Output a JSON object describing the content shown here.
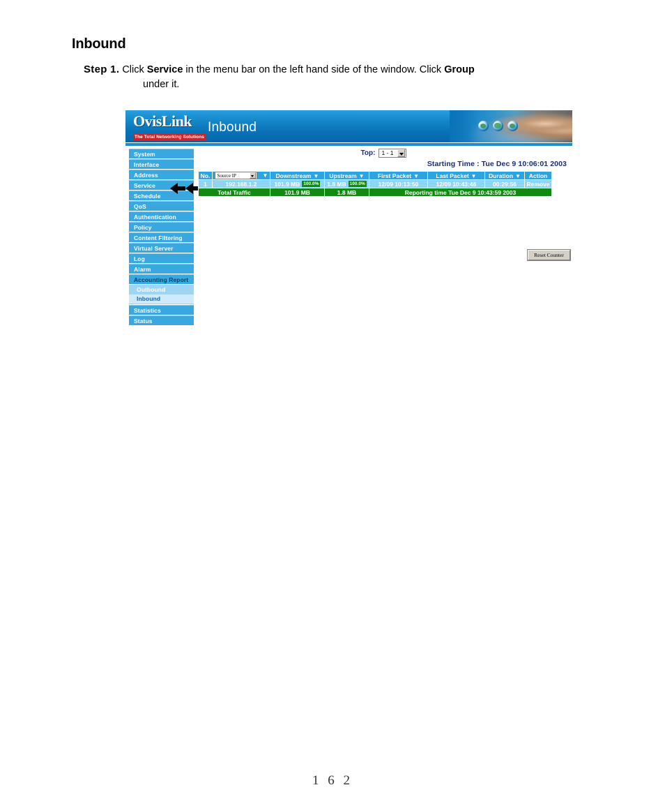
{
  "document": {
    "title": "Inbound",
    "step_label": "Step 1.",
    "step_text_1": "Click ",
    "step_bold_1": "Service",
    "step_text_2": " in the menu bar on the left hand side of the window. Click ",
    "step_bold_2": "Group",
    "step_text_3": "under it.",
    "page_number": "1 6 2"
  },
  "screenshot": {
    "banner": {
      "logo_main": "OvisLink",
      "logo_sub": "The Total Networking Solutions",
      "title": "Inbound",
      "icons": [
        "globe-icon",
        "globe-icon",
        "globe-icon"
      ]
    },
    "sidebar": {
      "items": [
        {
          "label": "System",
          "active": false
        },
        {
          "label": "Interface",
          "active": false
        },
        {
          "label": "Address",
          "active": false
        },
        {
          "label": "Service",
          "active": false
        },
        {
          "label": "Schedule",
          "active": false
        },
        {
          "label": "QoS",
          "active": false
        },
        {
          "label": "Authentication",
          "active": false
        },
        {
          "label": "Policy",
          "active": false
        },
        {
          "label": "Content Filtering",
          "active": false
        },
        {
          "label": "Virtual Server",
          "active": false
        },
        {
          "label": "Log",
          "active": false
        },
        {
          "label": "Alarm",
          "active": false
        },
        {
          "label": "Accounting Report",
          "active": true
        }
      ],
      "submenu": [
        {
          "label": "Outbound",
          "selected": false
        },
        {
          "label": "Inbound",
          "selected": true
        }
      ],
      "items_after": [
        {
          "label": "Statistics",
          "active": false
        },
        {
          "label": "Status",
          "active": false
        }
      ],
      "annotation": "two-left-arrows pointing at Inbound"
    },
    "panel": {
      "top_label": "Top:",
      "top_value": "1 - 1",
      "starting_time": "Starting Time : Tue Dec 9 10:06:01 2003",
      "table": {
        "headers": [
          {
            "label": "No.",
            "sort": false,
            "select": false
          },
          {
            "label": "Source IP",
            "sort": true,
            "select": true
          },
          {
            "label": "Downstream",
            "sort": true,
            "select": false
          },
          {
            "label": "Upstream",
            "sort": true,
            "select": false
          },
          {
            "label": "First Packet",
            "sort": true,
            "select": false
          },
          {
            "label": "Last Packet",
            "sort": true,
            "select": false
          },
          {
            "label": "Duration",
            "sort": true,
            "select": false
          },
          {
            "label": "Action",
            "sort": false,
            "select": false
          }
        ],
        "rows": [
          {
            "no": "1",
            "source_ip": "192.168.1.2",
            "downstream": "101.9 MB",
            "downstream_pct": "100.0%",
            "upstream": "1.8 MB",
            "upstream_pct": "100.0%",
            "first_packet": "12/09 10:13:50",
            "last_packet": "12/09 10:43:46",
            "duration": "00:29:56",
            "action": "Remove"
          }
        ],
        "total": {
          "label": "Total Traffic",
          "downstream": "101.9 MB",
          "upstream": "1.8 MB",
          "report_time": "Reporting time Tue Dec 9 10:43:59 2003"
        }
      },
      "reset_button": "Reset Counter"
    }
  },
  "colors": {
    "banner_blue": "#0a74b8",
    "sidebar_blue": "#3aa8e0",
    "submenu_blue": "#9ed5f2",
    "selected_blue": "#ceeafb",
    "table_header": "#2ea3dd",
    "table_row": "#8fd4f2",
    "total_green": "#128a12",
    "heading_navy": "#1a2a7a"
  }
}
